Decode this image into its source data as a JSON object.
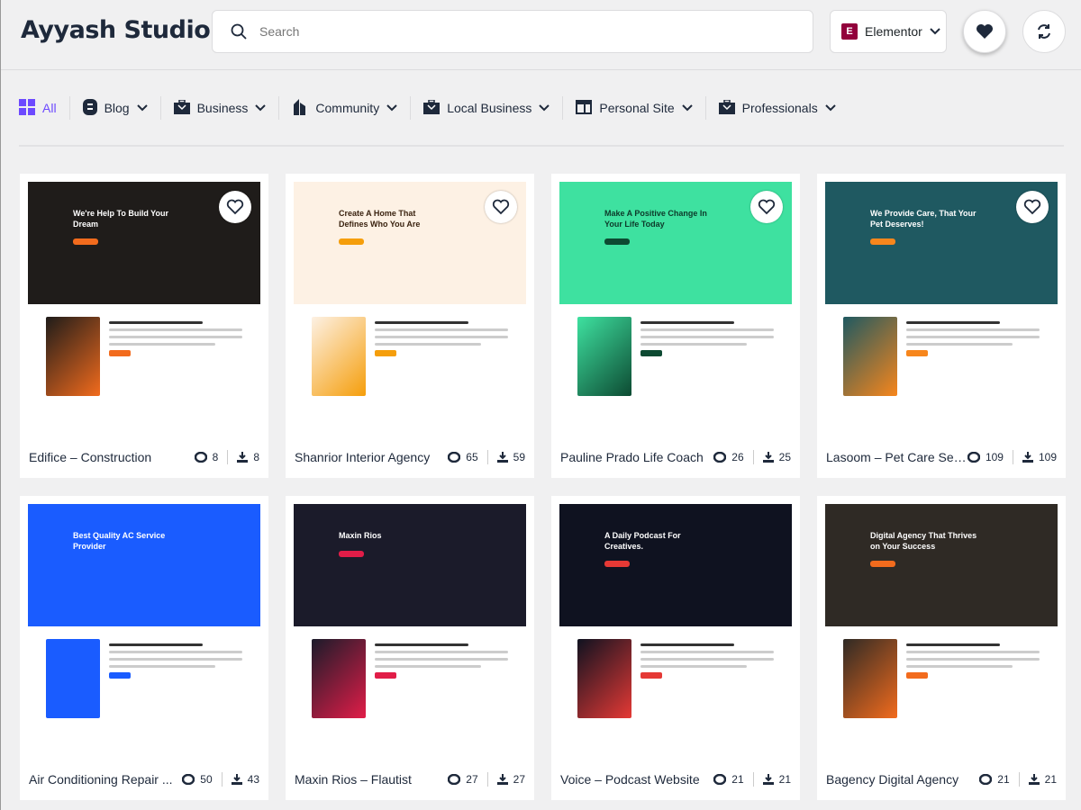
{
  "header": {
    "brand": "Ayyash Studio",
    "search_placeholder": "Search",
    "builder": "Elementor"
  },
  "categories": [
    {
      "label": "All",
      "icon": "grid-icon"
    },
    {
      "label": "Blog",
      "icon": "blog-icon"
    },
    {
      "label": "Business",
      "icon": "briefcase-icon"
    },
    {
      "label": "Community",
      "icon": "building-icon"
    },
    {
      "label": "Local Business",
      "icon": "briefcase-icon"
    },
    {
      "label": "Personal Site",
      "icon": "layout-icon"
    },
    {
      "label": "Professionals",
      "icon": "briefcase-icon"
    }
  ],
  "accent": "#6d4aff",
  "templates": [
    {
      "title": "Edifice – Construction",
      "views": "8",
      "downloads": "8",
      "headline": "We're Help To Build Your Dream",
      "hero": "#1f1c1a",
      "heroText": "#ffffff",
      "accent": "#f26b1d",
      "favorite_button": true
    },
    {
      "title": "Shanrior Interior Agency",
      "views": "65",
      "downloads": "59",
      "headline": "Create A Home That Defines Who You Are",
      "hero": "#fdf1e4",
      "heroText": "#3a2310",
      "accent": "#f59e0b",
      "favorite_button": true
    },
    {
      "title": "Pauline Prado Life Coach",
      "views": "26",
      "downloads": "25",
      "headline": "Make A Positive Change In Your Life Today",
      "hero": "#3ee1a0",
      "heroText": "#0d3a2a",
      "accent": "#0d4a32",
      "favorite_button": true
    },
    {
      "title": "Lasoom – Pet Care Ser...",
      "views": "109",
      "downloads": "109",
      "headline": "We Provide Care, That Your Pet Deserves!",
      "hero": "#1f5961",
      "heroText": "#ffffff",
      "accent": "#f7861c",
      "favorite_button": true
    },
    {
      "title": "Air Conditioning Repair ...",
      "views": "50",
      "downloads": "43",
      "headline": "Best Quality AC Service Provider",
      "hero": "#1a5cff",
      "heroText": "#ffffff",
      "accent": "#1a5cff",
      "favorite_button": false
    },
    {
      "title": "Maxin Rios – Flautist",
      "views": "27",
      "downloads": "27",
      "headline": "Maxin Rios",
      "hero": "#1b1b2a",
      "heroText": "#ffffff",
      "accent": "#e11d48",
      "favorite_button": false
    },
    {
      "title": "Voice – Podcast Website",
      "views": "21",
      "downloads": "21",
      "headline": "A Daily Podcast For Creatives.",
      "hero": "#0f1220",
      "heroText": "#ffffff",
      "accent": "#e53935",
      "favorite_button": false
    },
    {
      "title": "Bagency Digital Agency",
      "views": "21",
      "downloads": "21",
      "headline": "Digital Agency That Thrives on Your Success",
      "hero": "#2f2a25",
      "heroText": "#ffffff",
      "accent": "#f26b1d",
      "favorite_button": false
    }
  ]
}
